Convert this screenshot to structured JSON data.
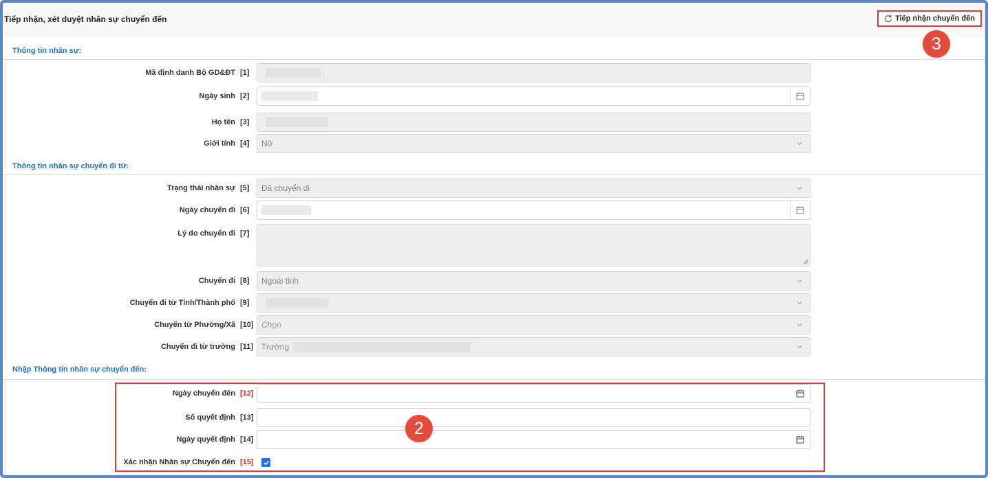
{
  "header": {
    "title": "Tiếp nhận, xét duyệt nhân sự chuyển đến",
    "receive_button": "Tiếp nhận chuyển đến"
  },
  "markers": {
    "m3": "3",
    "m2": "2"
  },
  "sections": {
    "personal": "Thông tin nhân sự:",
    "transfer_from": "Thông tin nhân sự chuyển đi từ:",
    "transfer_to": "Nhập Thông tin nhân sự chuyển đến:"
  },
  "fields": [
    {
      "label": "Mã định danh Bộ GD&ĐT",
      "num": "[1]"
    },
    {
      "label": "Ngày sinh",
      "num": "[2]"
    },
    {
      "label": "Họ tên",
      "num": "[3]"
    },
    {
      "label": "Giới tính",
      "num": "[4]",
      "value": "Nữ"
    },
    {
      "label": "Trạng thái nhân sự",
      "num": "[5]",
      "value": "Đã chuyển đi"
    },
    {
      "label": "Ngày chuyển đi",
      "num": "[6]"
    },
    {
      "label": "Lý do chuyển đi",
      "num": "[7]"
    },
    {
      "label": "Chuyển đi",
      "num": "[8]",
      "value": "Ngoài tỉnh"
    },
    {
      "label": "Chuyển đi từ Tỉnh/Thành phố",
      "num": "[9]"
    },
    {
      "label": "Chuyển từ Phường/Xã",
      "num": "[10]",
      "placeholder": "Chọn"
    },
    {
      "label": "Chuyển đi từ trường",
      "num": "[11]",
      "value": "Trường"
    },
    {
      "label": "Ngày chuyển đến",
      "num": "[12]"
    },
    {
      "label": "Số quyết định",
      "num": "[13]"
    },
    {
      "label": "Ngày quyết định",
      "num": "[14]"
    },
    {
      "label": "Xác nhận Nhân sự Chuyển đến",
      "num": "[15]",
      "checked": true
    }
  ],
  "colors": {
    "accent": "#1f74c8",
    "required": "#d22222",
    "highlight": "#e03c3c",
    "marker": "#e54b3c",
    "frame": "#5b87c8"
  }
}
